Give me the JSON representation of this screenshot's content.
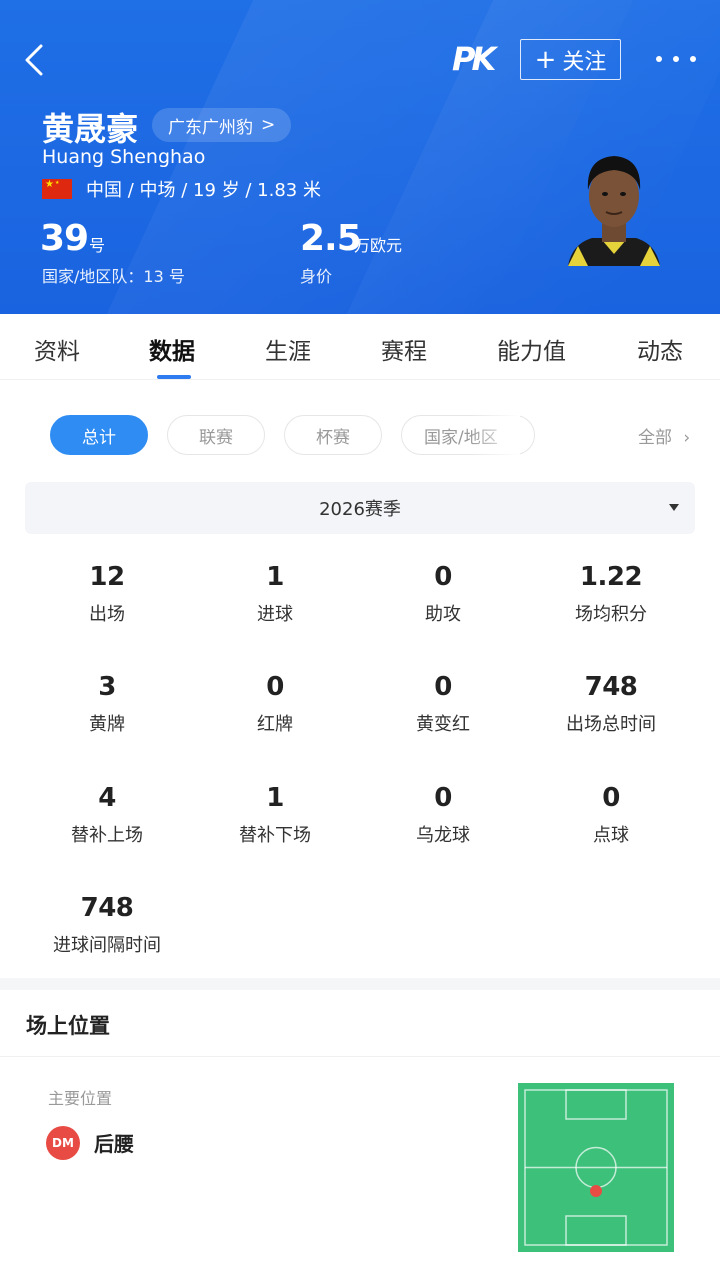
{
  "header": {
    "logo_text": "PK",
    "follow_plus": "+",
    "follow_label": "关注",
    "name_cn": "黄晟豪",
    "team": "广东广州豹",
    "team_chevron": ">",
    "name_en": "Huang Shenghao",
    "bio": "中国 / 中场 / 19 岁 / 1.83 米",
    "number": "39",
    "number_unit": "号",
    "national_number": "国家/地区队：13 号",
    "value": "2.5",
    "value_unit": "万欧元",
    "value_label": "身价",
    "colors": {
      "primary": "#1f6fe6",
      "accent": "#2f8cf3",
      "badge": "#e84b43",
      "pitch": "#3cc07a"
    }
  },
  "tabs": [
    "资料",
    "数据",
    "生涯",
    "赛程",
    "能力值",
    "动态"
  ],
  "active_tab": "数据",
  "filters": {
    "chips": [
      "总计",
      "联赛",
      "杯赛",
      "国家/地区"
    ],
    "active": "总计",
    "all_label": "全部",
    "all_chevron": "›"
  },
  "season": {
    "selected": "2026赛季"
  },
  "stats": [
    {
      "value": "12",
      "label": "出场"
    },
    {
      "value": "1",
      "label": "进球"
    },
    {
      "value": "0",
      "label": "助攻"
    },
    {
      "value": "1.22",
      "label": "场均积分"
    },
    {
      "value": "3",
      "label": "黄牌"
    },
    {
      "value": "0",
      "label": "红牌"
    },
    {
      "value": "0",
      "label": "黄变红"
    },
    {
      "value": "748",
      "label": "出场总时间"
    },
    {
      "value": "4",
      "label": "替补上场"
    },
    {
      "value": "1",
      "label": "替补下场"
    },
    {
      "value": "0",
      "label": "乌龙球"
    },
    {
      "value": "0",
      "label": "点球"
    },
    {
      "value": "748",
      "label": "进球间隔时间"
    }
  ],
  "position": {
    "title": "场上位置",
    "subtitle": "主要位置",
    "badge": "DM",
    "name": "后腰"
  }
}
